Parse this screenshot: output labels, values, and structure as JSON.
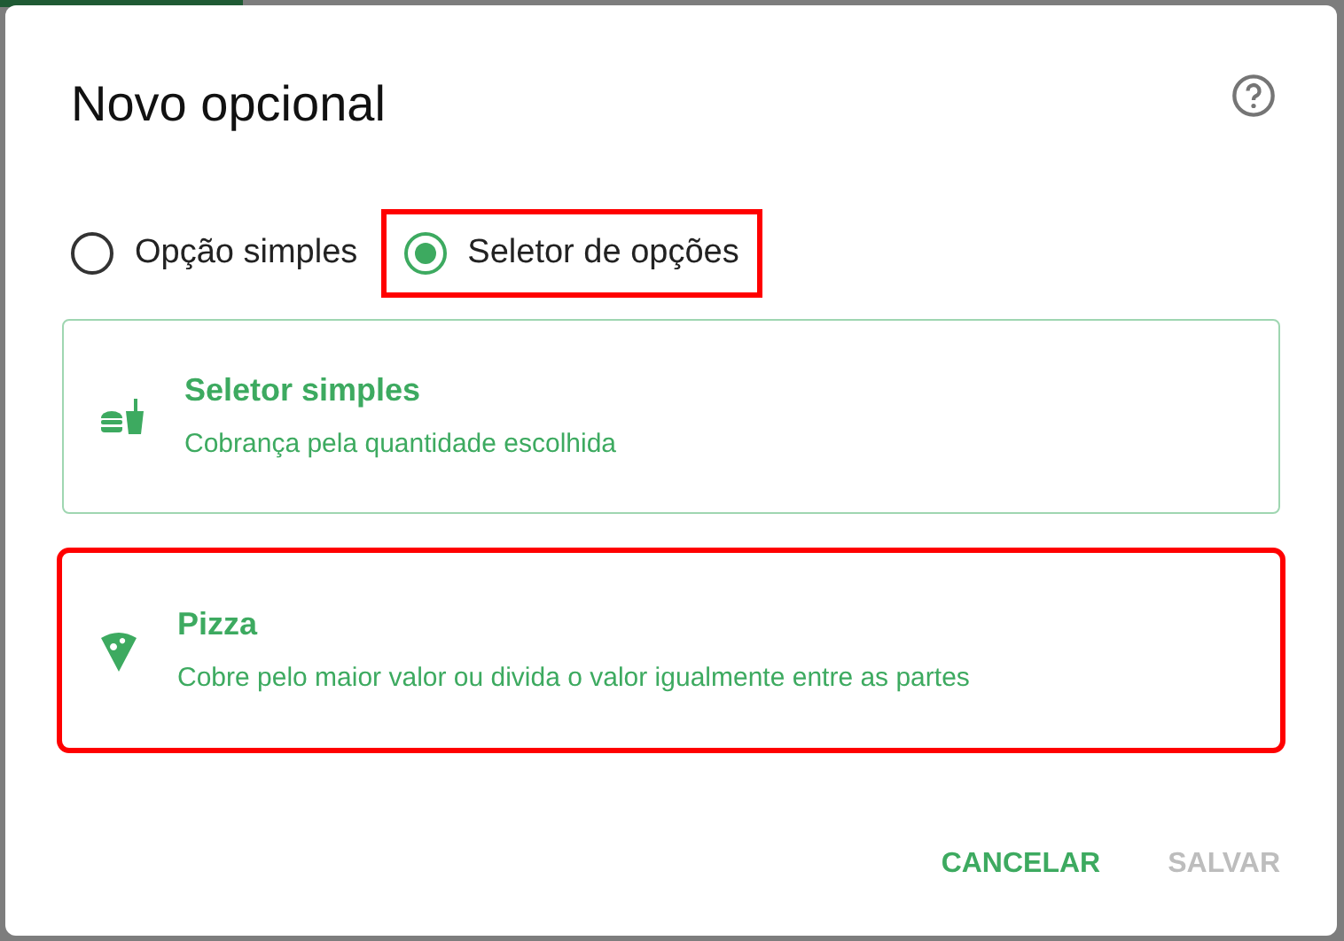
{
  "dialog": {
    "title": "Novo opcional"
  },
  "radios": [
    {
      "label": "Opção simples",
      "selected": false,
      "highlighted": false
    },
    {
      "label": "Seletor de opções",
      "selected": true,
      "highlighted": true
    }
  ],
  "options": [
    {
      "kind": "combo",
      "title": "Seletor simples",
      "description": "Cobrança pela quantidade escolhida",
      "selected": true,
      "highlighted": false
    },
    {
      "kind": "pizza",
      "title": "Pizza",
      "description": "Cobre pelo maior valor ou divida o valor igualmente entre as partes",
      "selected": false,
      "highlighted": true
    }
  ],
  "buttons": [
    {
      "label": "CANCELAR",
      "disabled": false
    },
    {
      "label": "SALVAR",
      "disabled": true
    }
  ]
}
